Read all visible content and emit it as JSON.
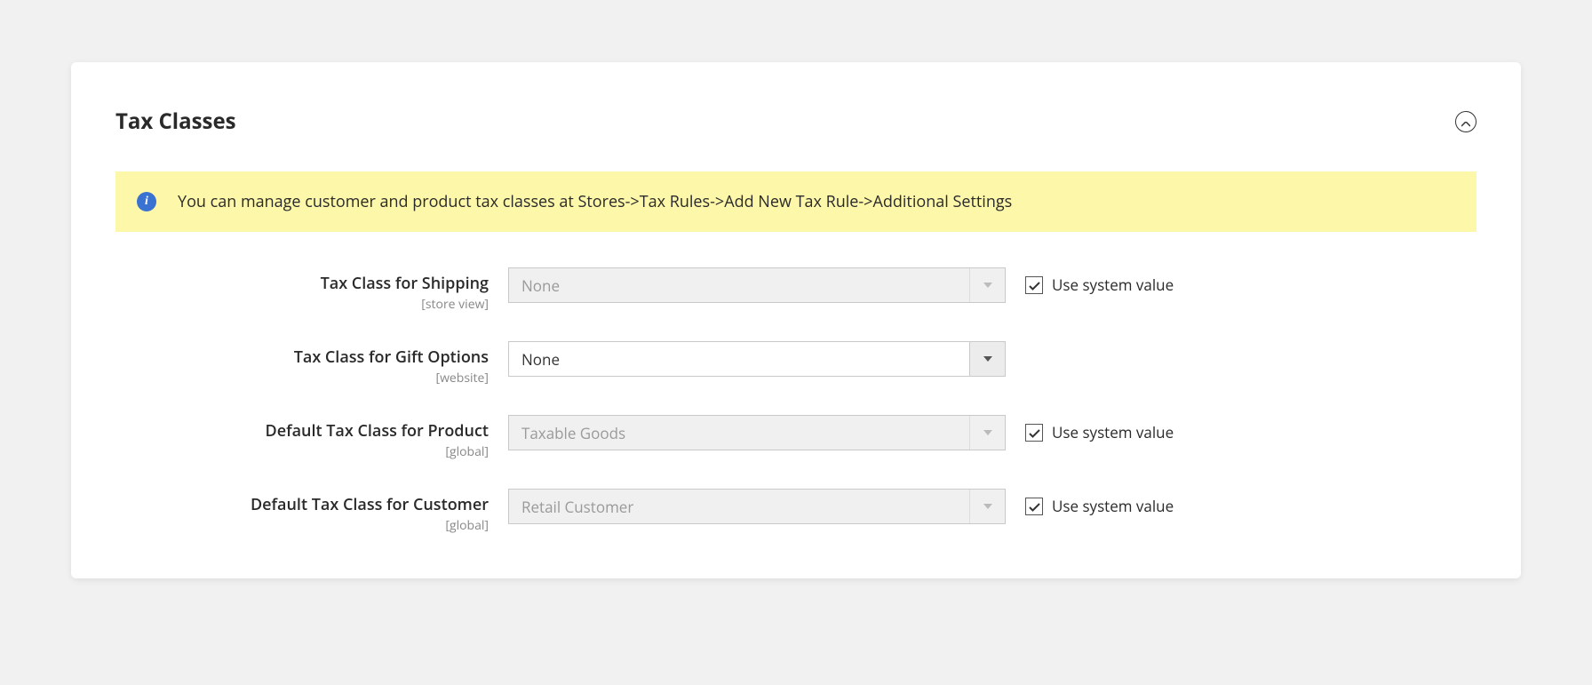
{
  "panel": {
    "title": "Tax Classes",
    "info_message": "You can manage customer and product tax classes at Stores->Tax Rules->Add New Tax Rule->Additional Settings",
    "use_system_value_label": "Use system value",
    "fields": [
      {
        "label": "Tax Class for Shipping",
        "scope": "[store view]",
        "value": "None",
        "disabled": true,
        "use_system": true
      },
      {
        "label": "Tax Class for Gift Options",
        "scope": "[website]",
        "value": "None",
        "disabled": false,
        "use_system": null
      },
      {
        "label": "Default Tax Class for Product",
        "scope": "[global]",
        "value": "Taxable Goods",
        "disabled": true,
        "use_system": true
      },
      {
        "label": "Default Tax Class for Customer",
        "scope": "[global]",
        "value": "Retail Customer",
        "disabled": true,
        "use_system": true
      }
    ]
  }
}
